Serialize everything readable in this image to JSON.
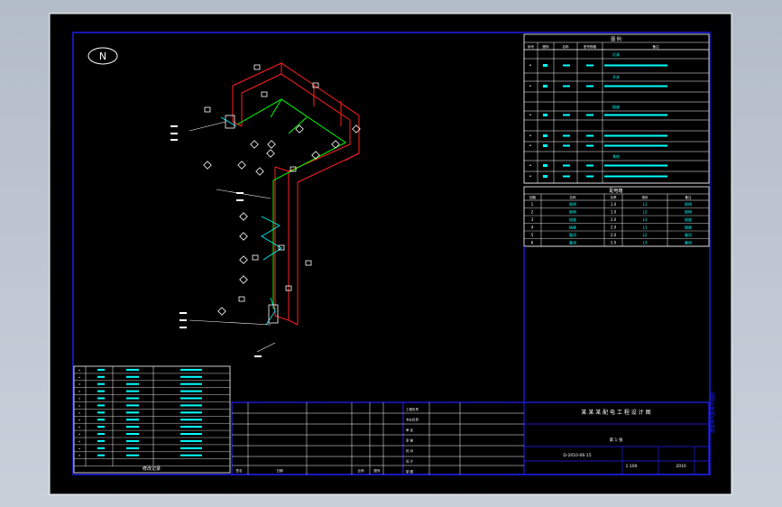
{
  "compass": {
    "label": "N"
  },
  "legend_header": {
    "title": "图  例"
  },
  "legend_cols": [
    "序号",
    "图例",
    "名称",
    "型号规格",
    "备注"
  ],
  "legend_sections": [
    {
      "label": "灯具"
    },
    {
      "label": "开关"
    },
    {
      "label": "插座"
    },
    {
      "label": "其他"
    }
  ],
  "load_title": "配电箱",
  "load_cols": [
    "回路",
    "名称",
    "功率",
    "相序",
    "备注"
  ],
  "load_rows": [
    {
      "no": "1",
      "name": "照明",
      "p": "1.0",
      "ph": "L1",
      "note": "照明"
    },
    {
      "no": "2",
      "name": "照明",
      "p": "1.0",
      "ph": "L2",
      "note": "照明"
    },
    {
      "no": "3",
      "name": "插座",
      "p": "2.0",
      "ph": "L3",
      "note": "插座"
    },
    {
      "no": "4",
      "name": "插座",
      "p": "2.0",
      "ph": "L1",
      "note": "插座"
    },
    {
      "no": "5",
      "name": "备用",
      "p": "2.0",
      "ph": "L2",
      "note": "备用"
    },
    {
      "no": "6",
      "name": "备用",
      "p": "2.0",
      "ph": "L3",
      "note": "备用"
    }
  ],
  "rev_table_title": "修改记录",
  "title_block": {
    "project": "某 某 某 配 电 工 程 设 计 图",
    "drawing_no": "D-2010-06-15",
    "scale": "1:100",
    "date": "2010",
    "sheet_label": "第 1 张",
    "left_labels": [
      "工程负责",
      "专业负责",
      "审  定",
      "审  核",
      "校  对",
      "设  计",
      "制  图"
    ],
    "bottom_labels": [
      "签名",
      "日期",
      "比例",
      "图号"
    ]
  },
  "side_label": "建筑电气配电平面图",
  "colors": {
    "frame": "#2020ff",
    "table_text": "#00ffff",
    "wall": "#ff2020",
    "wire": "#00ff00",
    "symbol": "#ffffff"
  }
}
